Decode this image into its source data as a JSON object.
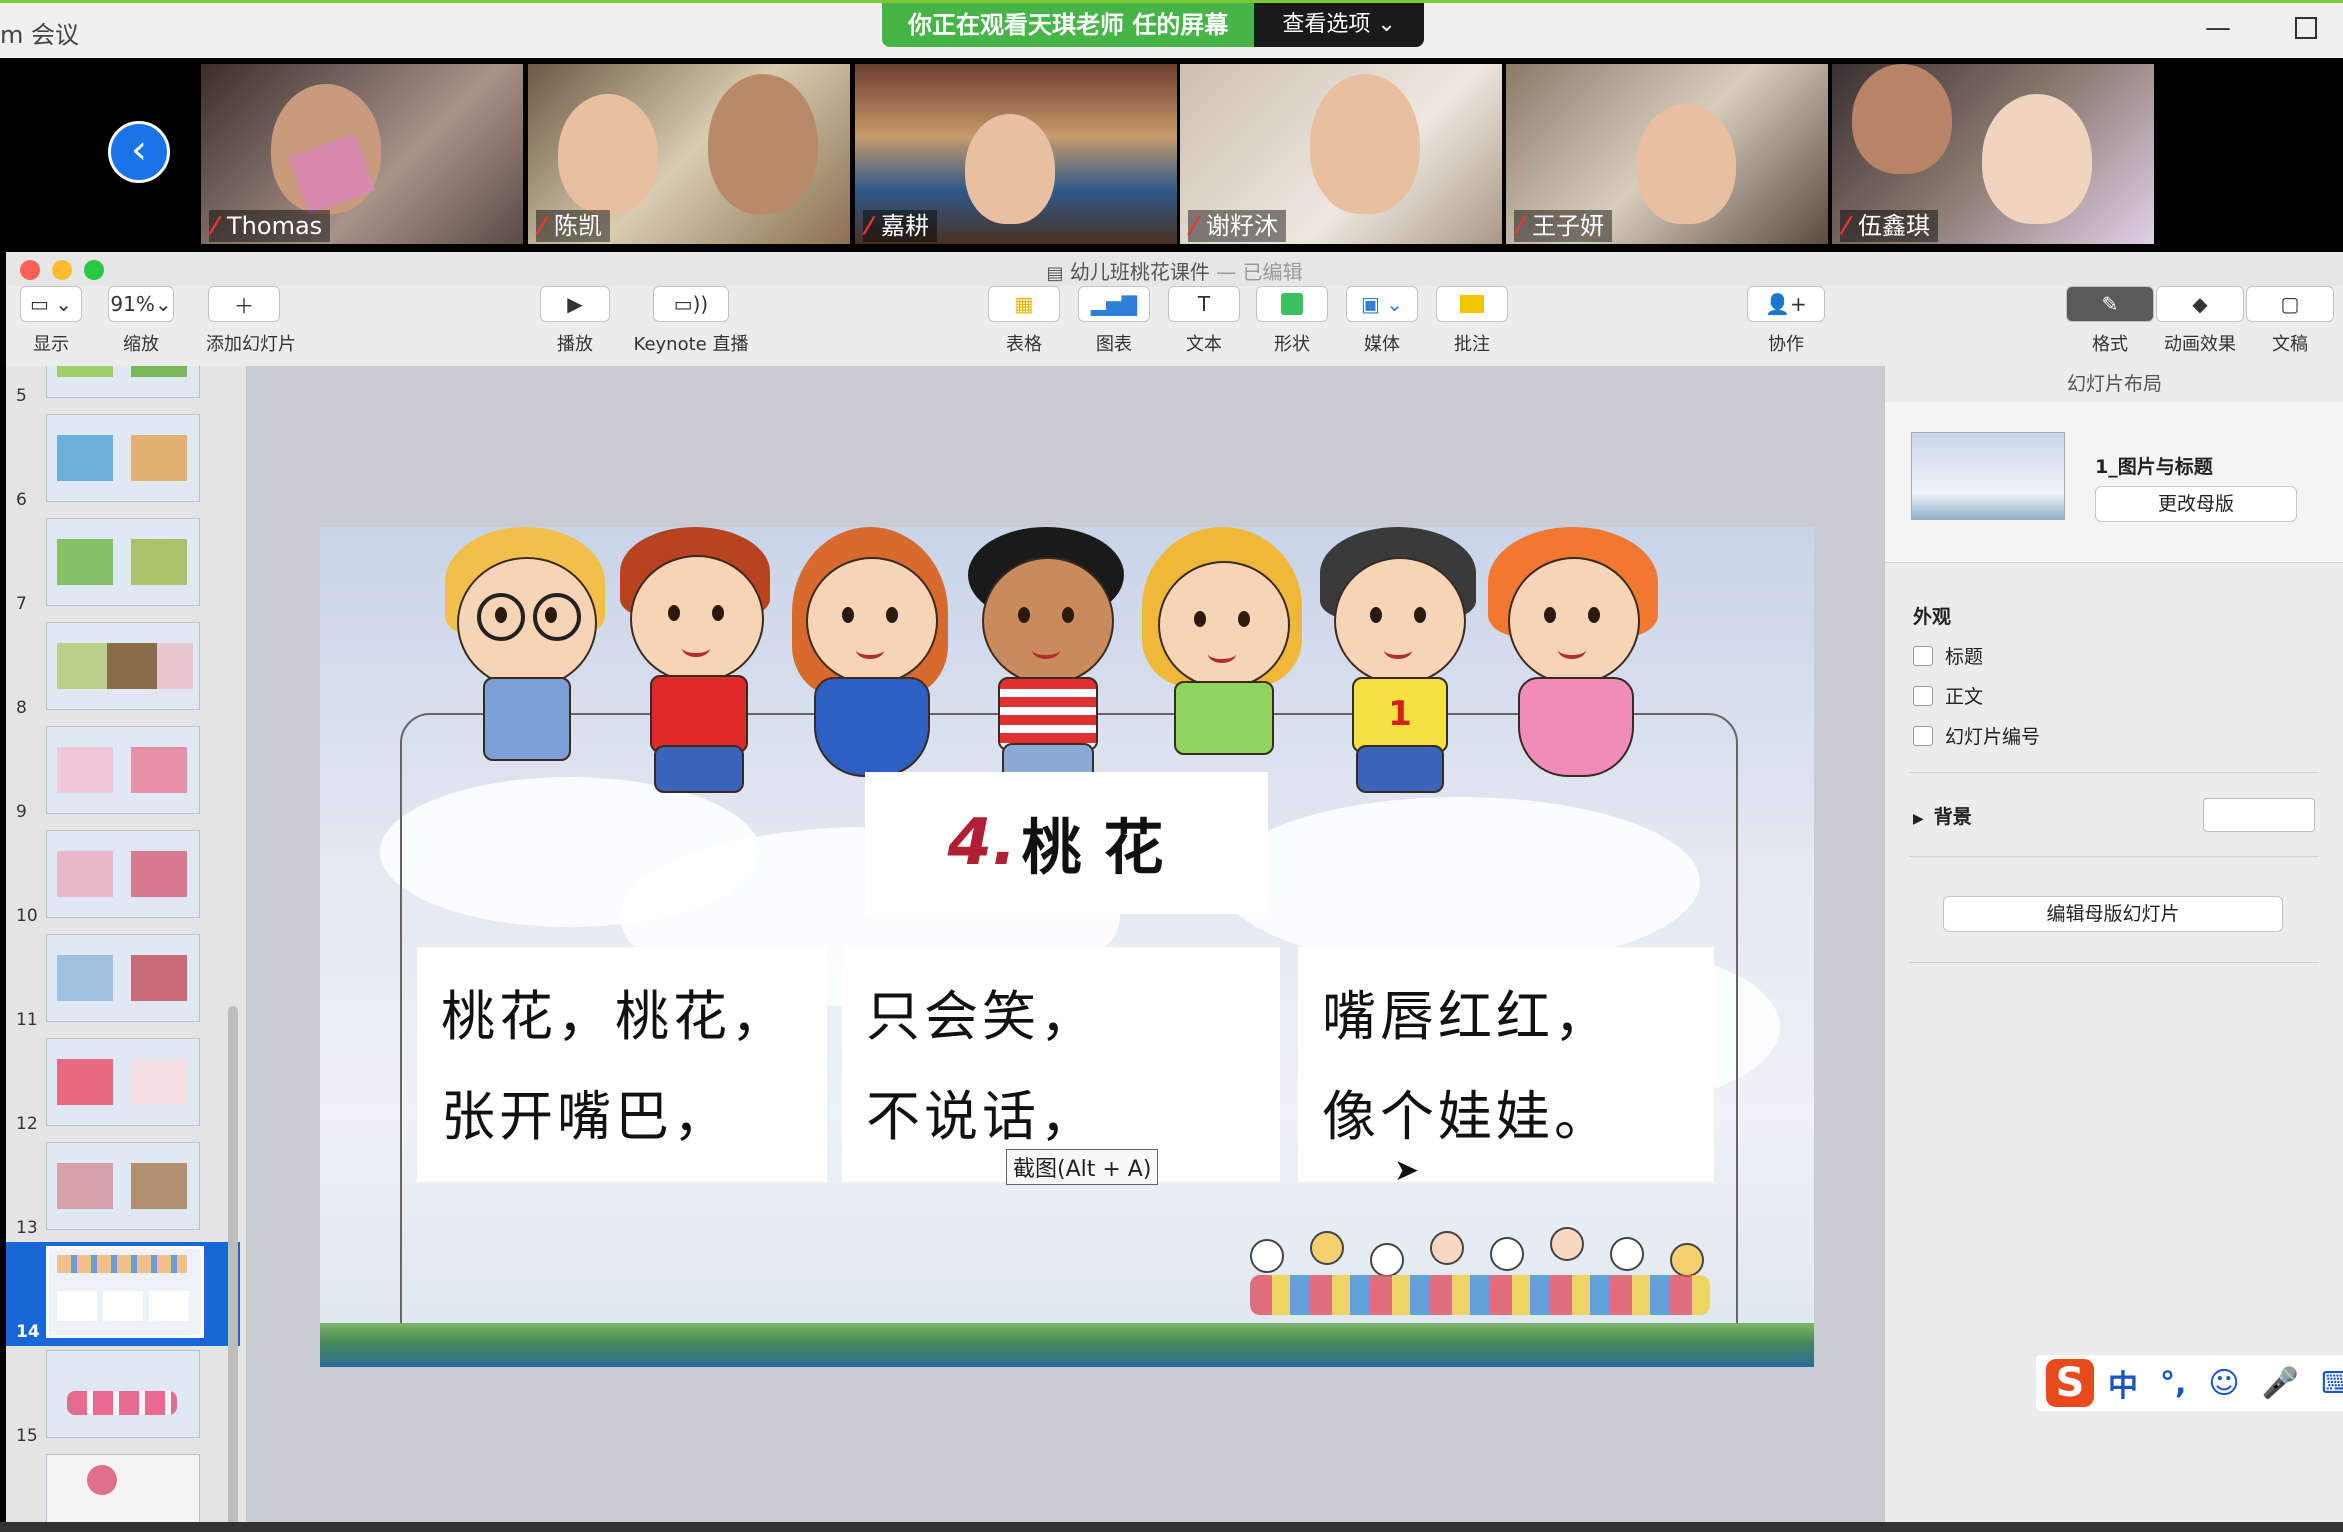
{
  "zoom": {
    "window_title": "m 会议",
    "share_banner": "你正在观看天琪老师 任的屏幕",
    "view_options": "查看选项 ⌄",
    "participants": [
      {
        "name": "Thomas"
      },
      {
        "name": "陈凯"
      },
      {
        "name": "嘉耕"
      },
      {
        "name": "谢籽沐"
      },
      {
        "name": "王子妍"
      },
      {
        "name": "伍鑫琪"
      }
    ]
  },
  "keynote": {
    "doc_title": "幼儿班桃花课件",
    "doc_status": "— 已编辑",
    "toolbar": {
      "view": "显示",
      "zoom_value": "91%",
      "zoom": "缩放",
      "add_slide": "添加幻灯片",
      "play": "播放",
      "keynote_live": "Keynote 直播",
      "table": "表格",
      "chart": "图表",
      "text": "文本",
      "shape": "形状",
      "media": "媒体",
      "comment": "批注",
      "collaborate": "协作",
      "format": "格式",
      "animate": "动画效果",
      "document": "文稿"
    },
    "slides": [
      {
        "num": "5"
      },
      {
        "num": "6"
      },
      {
        "num": "7"
      },
      {
        "num": "8"
      },
      {
        "num": "9"
      },
      {
        "num": "10"
      },
      {
        "num": "11"
      },
      {
        "num": "12"
      },
      {
        "num": "13"
      },
      {
        "num": "14"
      },
      {
        "num": "15"
      }
    ],
    "selected_slide": "14",
    "slide": {
      "number_label": "4.",
      "title": "桃花",
      "verses": [
        {
          "line1": "桃花，桃花，",
          "line2": "张开嘴巴，"
        },
        {
          "line1": "只会笑，",
          "line2": "不说话，"
        },
        {
          "line1": "嘴唇红红，",
          "line2": "像个娃娃。"
        }
      ]
    },
    "tooltip": "截图(Alt + A)",
    "inspector": {
      "header": "幻灯片布局",
      "layout_name": "1_图片与标题",
      "change_master": "更改母版",
      "appearance": "外观",
      "title_opt": "标题",
      "body_opt": "正文",
      "slide_number_opt": "幻灯片编号",
      "background": "背景",
      "edit_master": "编辑母版幻灯片"
    }
  },
  "ime": {
    "logo": "S",
    "chinese": "中",
    "punct": "°,",
    "emoji": "☺",
    "mic": "🎤",
    "keyboard": "⌨"
  },
  "colors": {
    "zoom_green": "#46b446",
    "keynote_selection": "#1767d6",
    "slide_number_red": "#b01f34"
  }
}
